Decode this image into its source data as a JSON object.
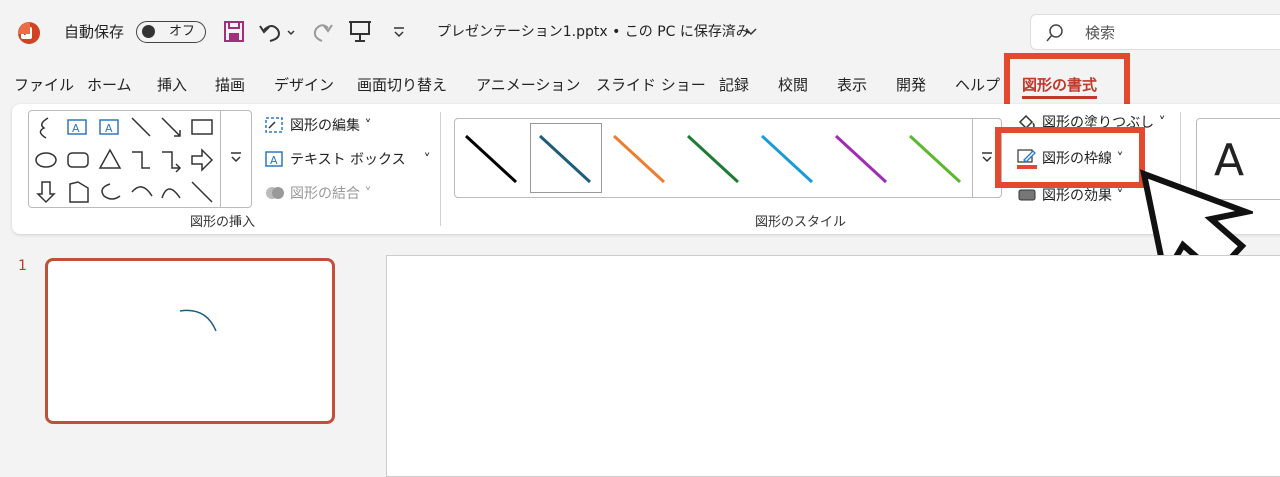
{
  "titlebar": {
    "autosave_label": "自動保存",
    "autosave_state": "オフ",
    "filename": "プレゼンテーション1.pptx • この PC に保存済み",
    "search_placeholder": "検索"
  },
  "tabs": [
    {
      "label": "ファイル"
    },
    {
      "label": "ホーム"
    },
    {
      "label": "挿入"
    },
    {
      "label": "描画"
    },
    {
      "label": "デザイン"
    },
    {
      "label": "画面切り替え"
    },
    {
      "label": "アニメーション"
    },
    {
      "label": "スライド ショー"
    },
    {
      "label": "記録"
    },
    {
      "label": "校閲"
    },
    {
      "label": "表示"
    },
    {
      "label": "開発"
    },
    {
      "label": "ヘルプ"
    },
    {
      "label": "図形の書式",
      "active": true
    }
  ],
  "ribbon": {
    "insert_group": {
      "label": "図形の挿入",
      "edit_shape": "図形の編集",
      "text_box": "テキスト ボックス",
      "merge_shapes": "図形の結合"
    },
    "style_group": {
      "label": "図形のスタイル",
      "line_colors": [
        "#000000",
        "#1f5c7a",
        "#ed7d31",
        "#1e7b34",
        "#1a9bd7",
        "#a02cb4",
        "#5db82e"
      ],
      "fill": "図形の塗りつぶし",
      "outline": "図形の枠線",
      "effects": "図形の効果"
    },
    "wordart_letter": "A"
  },
  "slides": {
    "number": "1"
  },
  "colors": {
    "accent": "#c0392b",
    "highlight": "#e2492f"
  }
}
